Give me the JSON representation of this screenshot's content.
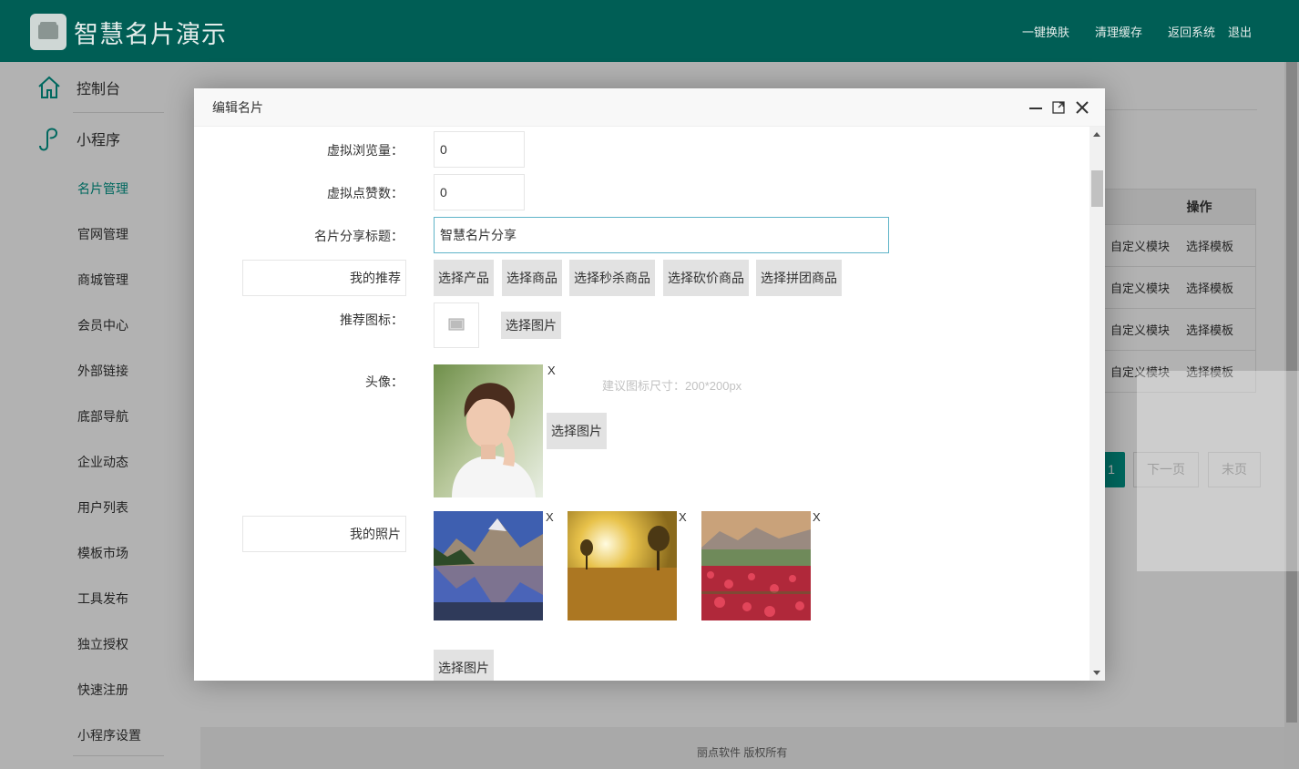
{
  "header": {
    "title": "智慧名片演示",
    "menu": [
      "一键换肤",
      "清理缓存",
      "返回系统",
      "退出"
    ]
  },
  "sidebar": {
    "dashboard": "控制台",
    "miniprogram": "小程序",
    "items": [
      "名片管理",
      "官网管理",
      "商城管理",
      "会员中心",
      "外部链接",
      "底部导航",
      "企业动态",
      "用户列表",
      "模板市场",
      "工具发布",
      "独立授权",
      "快速注册",
      "小程序设置"
    ],
    "active_index": 0
  },
  "background": {
    "table_header": "操作",
    "row_actions": [
      "自定义模块",
      "选择模板"
    ],
    "page_current": "1",
    "next_page": "下一页",
    "last_page": "末页",
    "footer": "丽点软件 版权所有"
  },
  "dialog": {
    "title": "编辑名片",
    "virtual_views_label": "虚拟浏览量：",
    "virtual_views_value": "0",
    "virtual_likes_label": "虚拟点赞数：",
    "virtual_likes_value": "0",
    "share_title_label": "名片分享标题：",
    "share_title_value": "智慧名片分享",
    "recommend_input": "我的推荐",
    "recommend_buttons": [
      "选择产品",
      "选择商品",
      "选择秒杀商品",
      "选择砍价商品",
      "选择拼团商品"
    ],
    "recommend_icon_label": "推荐图标：",
    "select_image": "选择图片",
    "avatar_label": "头像：",
    "avatar_hint": "建议图标尺寸：200*200px",
    "remove_mark": "X",
    "photos_input": "我的照片"
  },
  "colors": {
    "brand": "#005e55",
    "accent": "#009688"
  }
}
